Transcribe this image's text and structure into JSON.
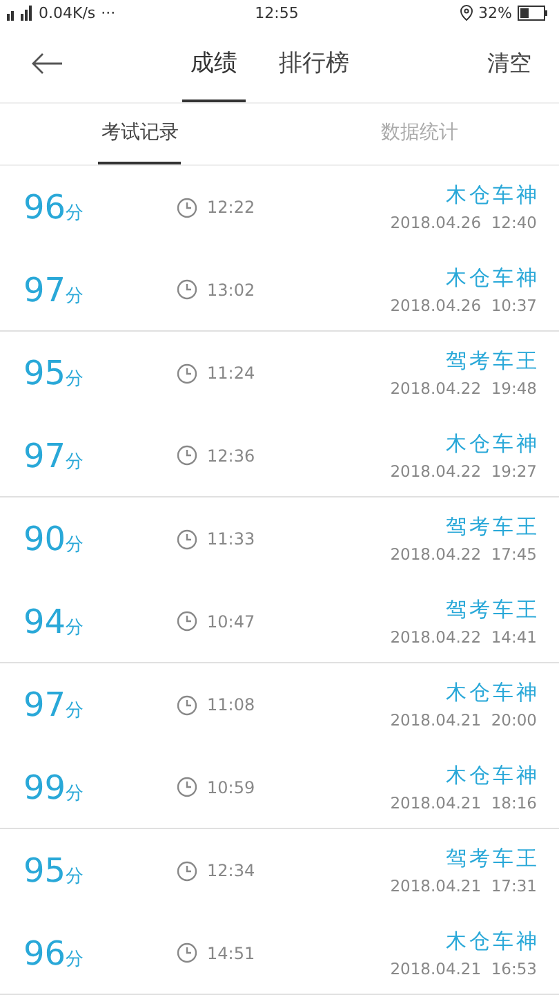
{
  "status_bar": {
    "speed": "0.04K/s",
    "more": "···",
    "time": "12:55",
    "battery": "32%"
  },
  "nav": {
    "tabs": [
      {
        "label": "成绩",
        "selected": true
      },
      {
        "label": "排行榜",
        "selected": false
      }
    ],
    "action": "清空"
  },
  "subtabs": [
    {
      "label": "考试记录",
      "selected": true
    },
    {
      "label": "数据统计",
      "selected": false
    }
  ],
  "records": [
    {
      "score": "96",
      "unit": "分",
      "duration": "12:22",
      "title": "木仓车神",
      "datetime": "2018.04.26  12:40"
    },
    {
      "score": "97",
      "unit": "分",
      "duration": "13:02",
      "title": "木仓车神",
      "datetime": "2018.04.26  10:37"
    },
    {
      "score": "95",
      "unit": "分",
      "duration": "11:24",
      "title": "驾考车王",
      "datetime": "2018.04.22  19:48"
    },
    {
      "score": "97",
      "unit": "分",
      "duration": "12:36",
      "title": "木仓车神",
      "datetime": "2018.04.22  19:27"
    },
    {
      "score": "90",
      "unit": "分",
      "duration": "11:33",
      "title": "驾考车王",
      "datetime": "2018.04.22  17:45"
    },
    {
      "score": "94",
      "unit": "分",
      "duration": "10:47",
      "title": "驾考车王",
      "datetime": "2018.04.22  14:41"
    },
    {
      "score": "97",
      "unit": "分",
      "duration": "11:08",
      "title": "木仓车神",
      "datetime": "2018.04.21  20:00"
    },
    {
      "score": "99",
      "unit": "分",
      "duration": "10:59",
      "title": "木仓车神",
      "datetime": "2018.04.21  18:16"
    },
    {
      "score": "95",
      "unit": "分",
      "duration": "12:34",
      "title": "驾考车王",
      "datetime": "2018.04.21  17:31"
    },
    {
      "score": "96",
      "unit": "分",
      "duration": "14:51",
      "title": "木仓车神",
      "datetime": "2018.04.21  16:53"
    }
  ]
}
